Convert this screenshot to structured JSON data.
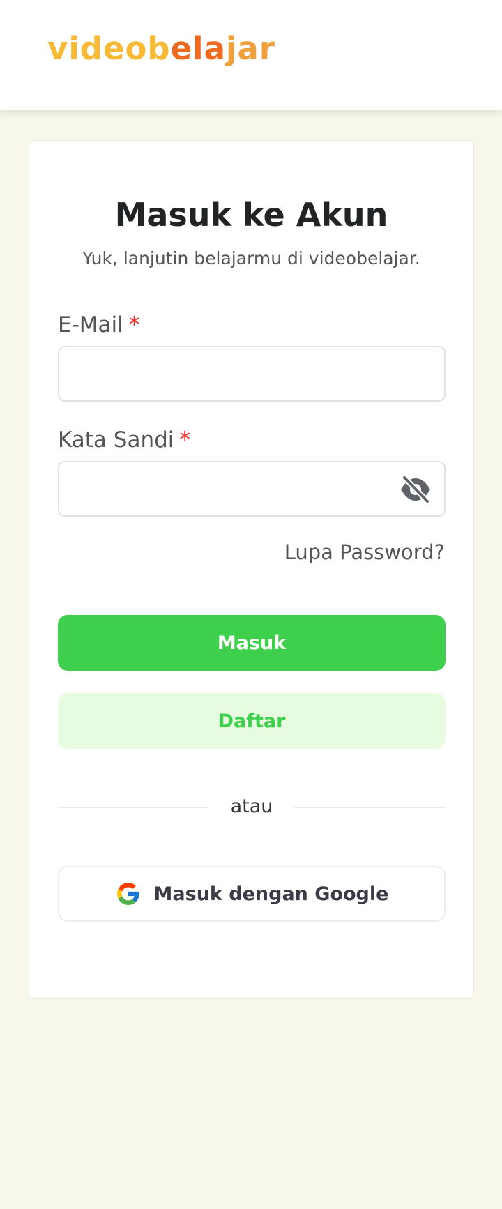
{
  "header": {
    "logo": {
      "part1": "videob",
      "part2": "ela",
      "part3": "jar"
    }
  },
  "login": {
    "title": "Masuk ke Akun",
    "subtitle": "Yuk, lanjutin belajarmu di videobelajar.",
    "email": {
      "label": "E-Mail",
      "required_mark": "*",
      "value": "",
      "placeholder": ""
    },
    "password": {
      "label": "Kata Sandi",
      "required_mark": "*",
      "value": "",
      "placeholder": "",
      "toggle_icon": "eye-off-icon"
    },
    "forgot_password": "Lupa Password?",
    "login_button": "Masuk",
    "register_button": "Daftar",
    "divider_text": "atau",
    "google_button": "Masuk dengan Google",
    "google_icon": "google-icon"
  },
  "colors": {
    "background": "#f8f8ea",
    "primary_green": "#3ecf4c",
    "secondary_green_bg": "#e6fbe0",
    "required_red": "#ff1f1f",
    "logo_yellow": "#f8b936",
    "logo_orange": "#ee6a1f"
  }
}
